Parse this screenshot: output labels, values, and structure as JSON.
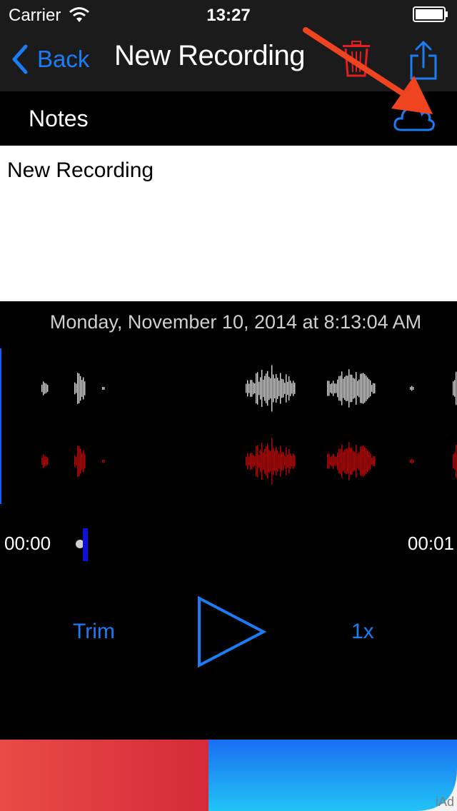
{
  "status_bar": {
    "carrier": "Carrier",
    "time": "13:27"
  },
  "nav": {
    "back_label": "Back",
    "title": "New Recording"
  },
  "notes": {
    "label": "Notes",
    "text": "New Recording"
  },
  "recording": {
    "date": "Monday, November 10, 2014 at 8:13:04 AM"
  },
  "playback": {
    "time_start": "00:00",
    "time_end": "00:01",
    "trim_label": "Trim",
    "speed_label": "1x"
  },
  "ad": {
    "label": "iAd"
  },
  "colors": {
    "accent": "#1b7df5",
    "trash": "#e21f1f",
    "annotation_arrow": "#f0431f",
    "waveform_top": "#d9d9d9",
    "waveform_bottom": "#c00000"
  },
  "icons": [
    "wifi-icon",
    "battery-icon",
    "back-chevron-icon",
    "trash-icon",
    "share-icon",
    "cloud-icon",
    "play-icon"
  ]
}
